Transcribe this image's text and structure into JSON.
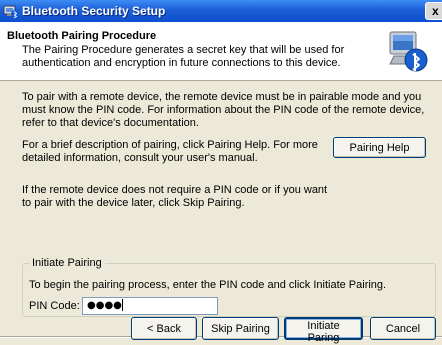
{
  "window": {
    "title": "Bluetooth Security Setup",
    "close_glyph": "x"
  },
  "header": {
    "title": "Bluetooth Pairing Procedure",
    "description": "The Pairing Procedure generates a secret key that will be used for authentication and encryption in future connections to this device."
  },
  "content": {
    "intro": "To pair with a remote device, the remote device must be in pairable mode and you must know the PIN code.  For information about the PIN code of the remote device, refer to that device's documentation.",
    "help_text": "For a brief description of pairing, click Pairing Help.  For more detailed information, consult your user's manual.",
    "skip_text": "If the remote device does not require a PIN code or if you want to pair with the device later, click Skip Pairing.",
    "pairing_help_label": "Pairing Help"
  },
  "group": {
    "label": "Initiate Pairing",
    "instruction": "To begin the pairing process, enter the PIN code and click Initiate Pairing.",
    "pin_label": "PIN Code:",
    "pin_value": "●●●●"
  },
  "buttons": {
    "back": "< Back",
    "skip": "Skip Pairing",
    "initiate": "Initiate Paring",
    "cancel": "Cancel"
  },
  "icons": {
    "app_icon": "bluetooth-app-icon",
    "header_icon": "bluetooth-computer-icon"
  },
  "colors": {
    "titlebar": "#1c5fd6",
    "dialog_bg": "#ece9d8",
    "bluetooth_blue": "#1a5fcf"
  }
}
